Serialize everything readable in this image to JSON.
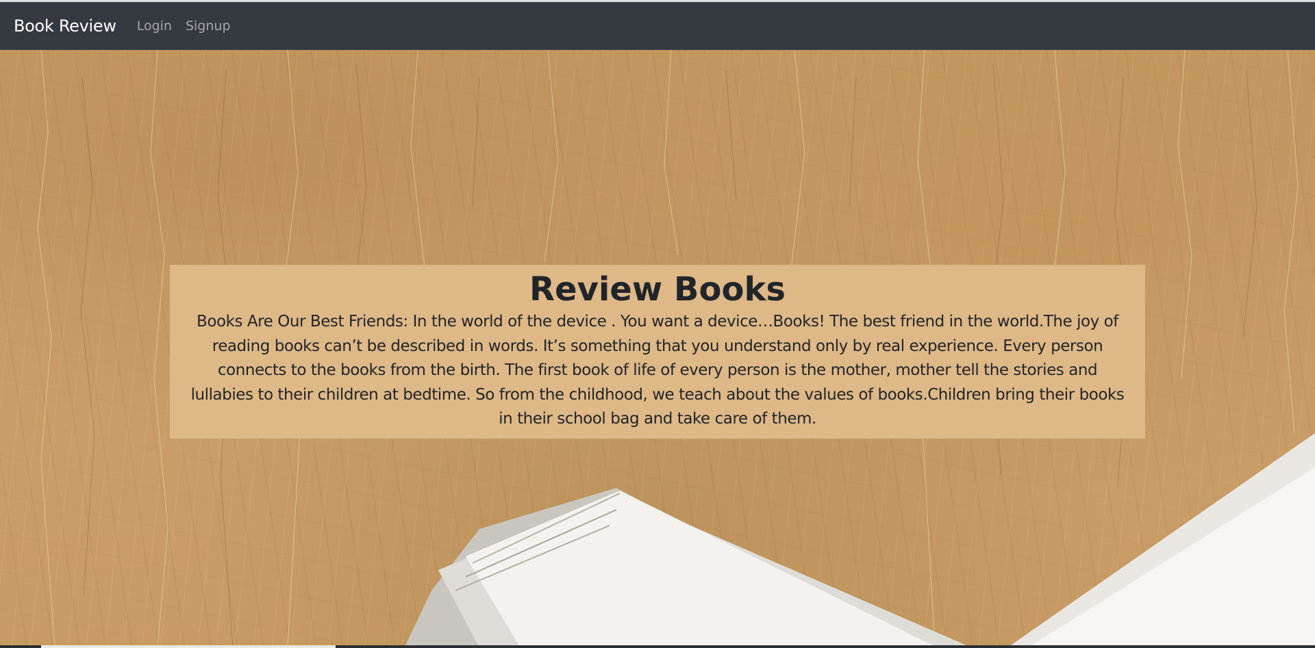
{
  "navbar": {
    "brand": "Book Review",
    "links": [
      "Login",
      "Signup"
    ]
  },
  "hero": {
    "title": "Review Books",
    "body": "Books Are Our Best Friends: In the world of the device . You want a device…Books! The best friend in the world.The joy of reading books can’t be described in words. It’s something that you understand only by real experience. Every person connects to the books from the birth. The first book of life of every person is the mother, mother tell the stories and lullabies to their children at bedtime. So from the childhood, we teach about the values of books.Children bring their books in their school bag and take care of them."
  },
  "colors": {
    "navbar_bg": "#343a40",
    "card_bg": "#deb887",
    "text": "#212529"
  }
}
